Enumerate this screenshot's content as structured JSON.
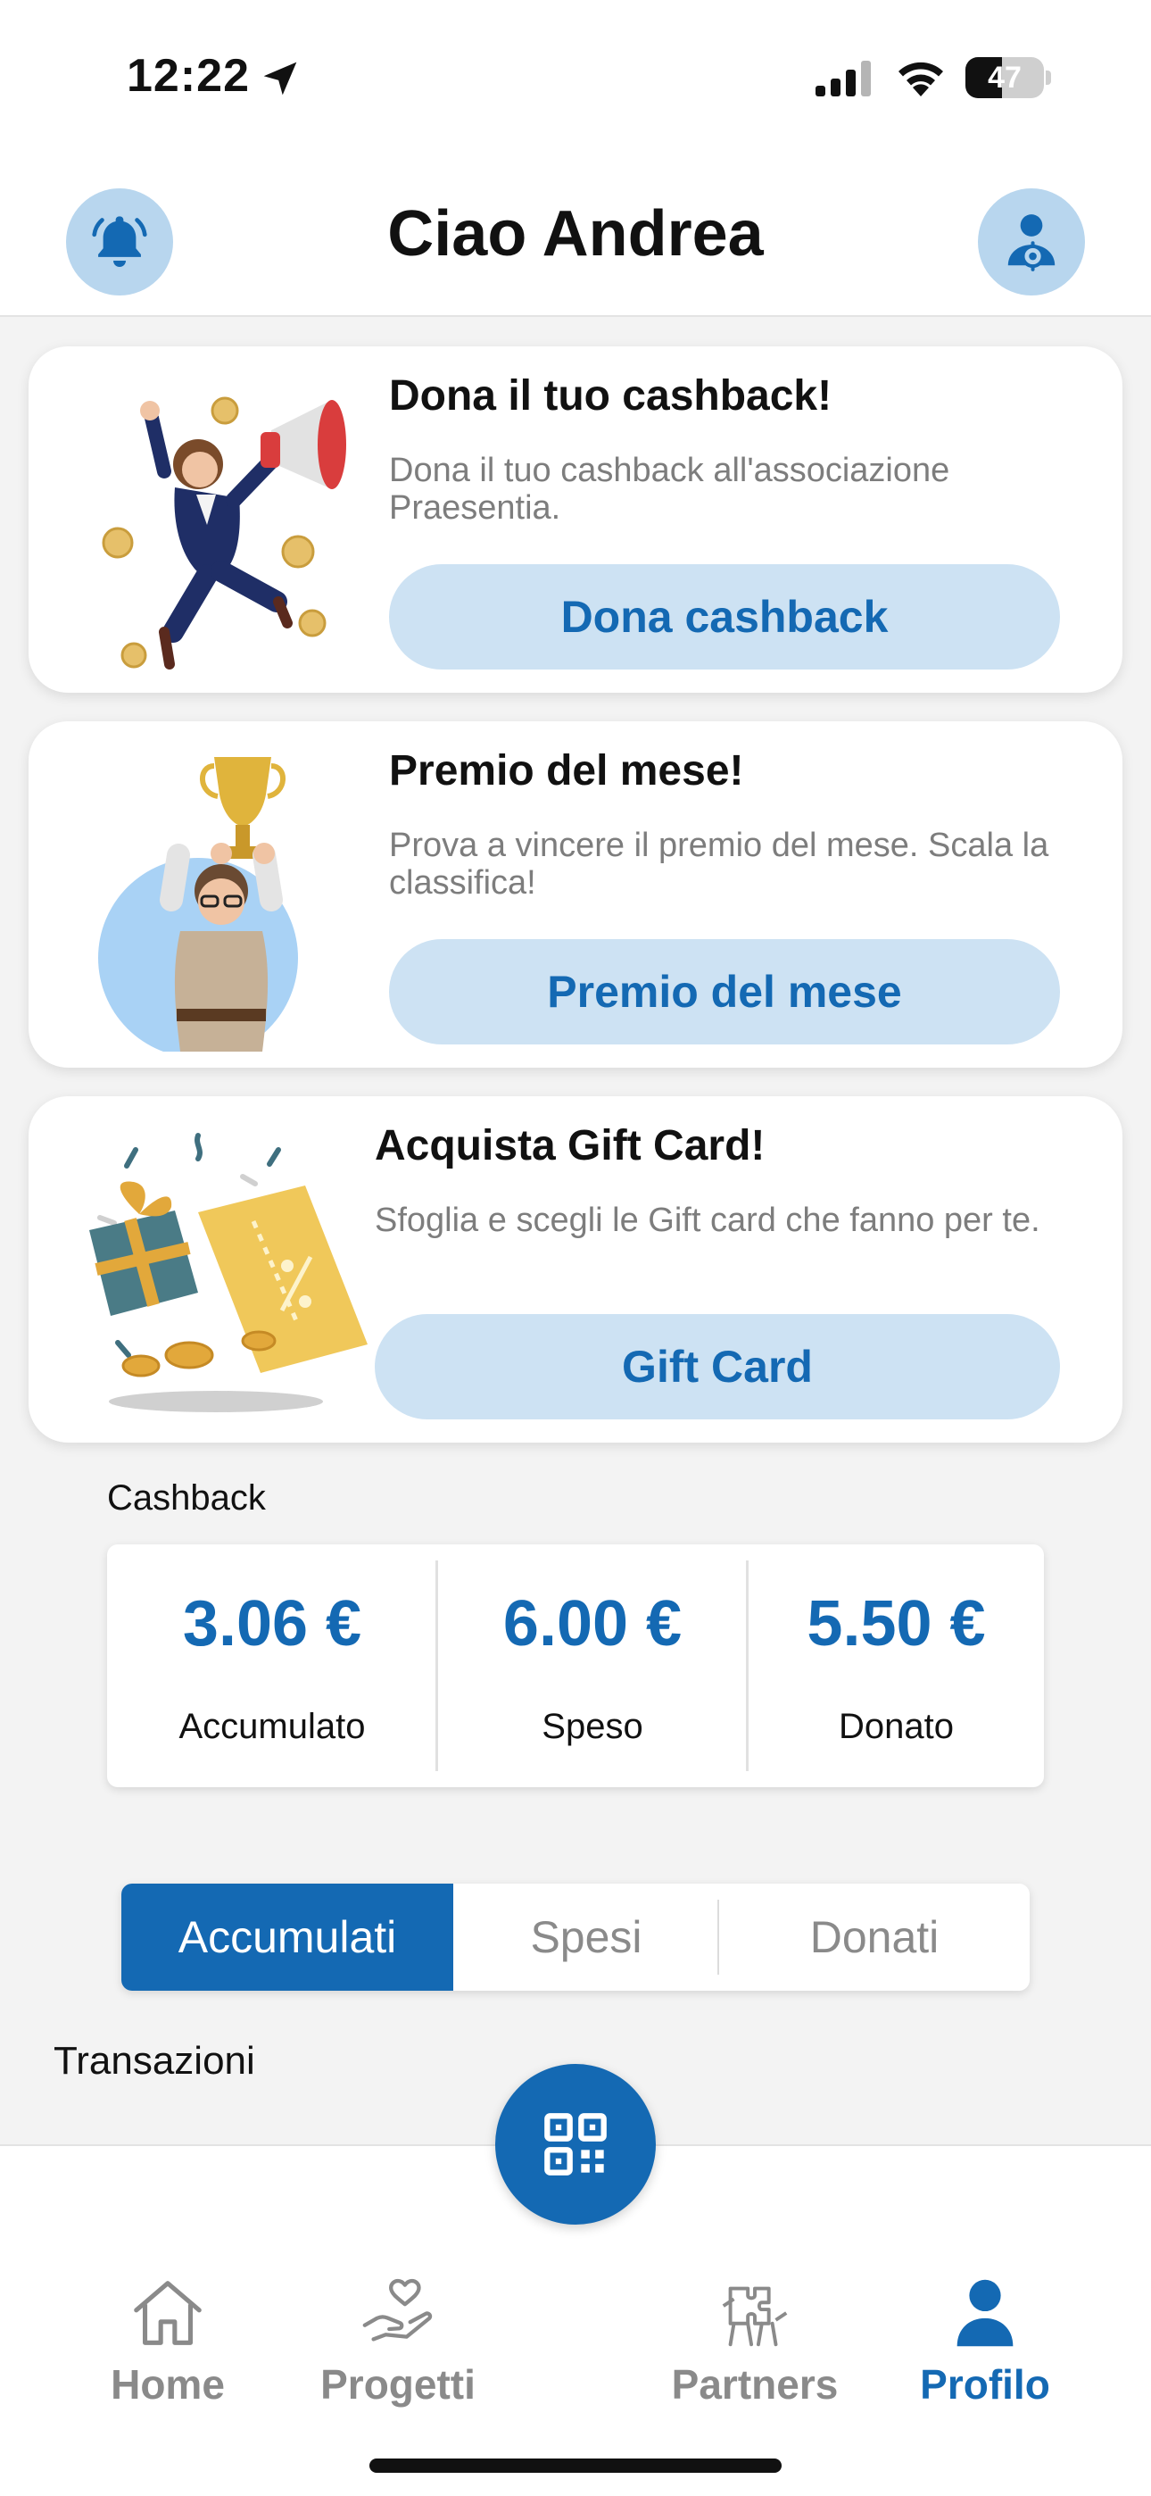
{
  "status_bar": {
    "time": "12:22",
    "battery": "47",
    "battery_level": 0.47
  },
  "header": {
    "title": "Ciao Andrea"
  },
  "cards": [
    {
      "title": "Dona il tuo cashback!",
      "description": "Dona il tuo cashback all'associazione Praesentia.",
      "button": "Dona cashback"
    },
    {
      "title": "Premio del mese!",
      "description": "Prova a vincere il premio del mese. Scala la classifica!",
      "button": "Premio del mese"
    },
    {
      "title": "Acquista Gift Card!",
      "description": "Sfoglia e scegli le Gift card che fanno per te.",
      "button": "Gift Card"
    }
  ],
  "cashback": {
    "label": "Cashback",
    "stats": [
      {
        "value": "3.06 €",
        "label": "Accumulato"
      },
      {
        "value": "6.00 €",
        "label": "Speso"
      },
      {
        "value": "5.50 €",
        "label": "Donato"
      }
    ]
  },
  "tabs": [
    {
      "label": "Accumulati",
      "active": true
    },
    {
      "label": "Spesi",
      "active": false
    },
    {
      "label": "Donati",
      "active": false
    }
  ],
  "transactions": {
    "label": "Transazioni"
  },
  "nav": [
    {
      "label": "Home",
      "icon": "home-icon",
      "active": false
    },
    {
      "label": "Progetti",
      "icon": "heart-hand-icon",
      "active": false
    },
    {
      "label": "Partners",
      "icon": "puzzle-hands-icon",
      "active": false
    },
    {
      "label": "Profilo",
      "icon": "person-icon",
      "active": true
    }
  ],
  "colors": {
    "accent": "#1469b3",
    "accent_light": "#cde2f3",
    "icon_bg": "#b8d6ee"
  }
}
